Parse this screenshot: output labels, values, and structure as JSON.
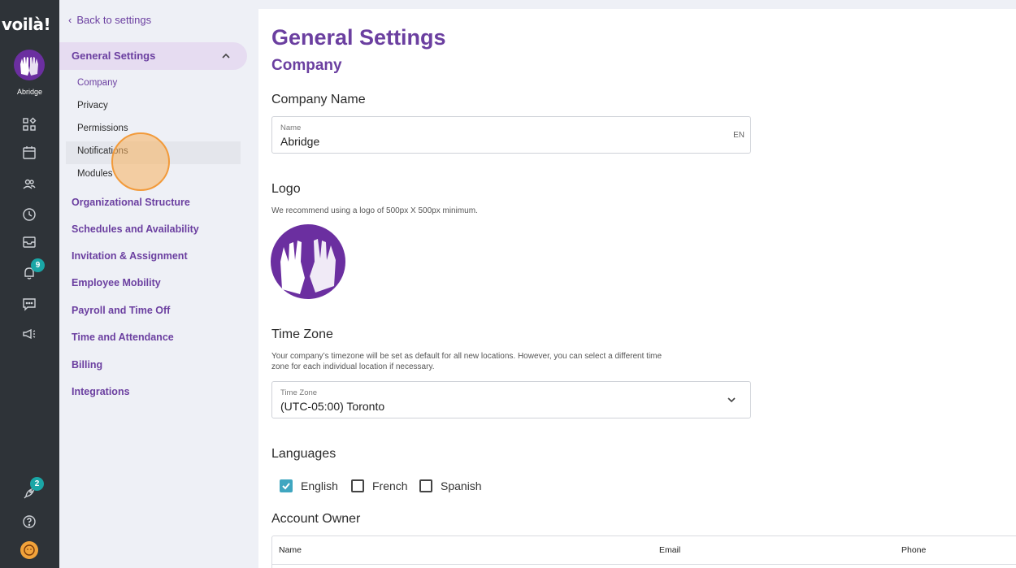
{
  "rail": {
    "brand": "voilà!",
    "org_name": "Abridge",
    "notifications_badge": "9",
    "launch_badge": "2",
    "icons": [
      "dashboard-icon",
      "calendar-icon",
      "people-icon",
      "clock-icon",
      "inbox-icon",
      "bell-icon",
      "chat-icon",
      "megaphone-icon",
      "rocket-icon",
      "help-icon",
      "user-avatar"
    ]
  },
  "sidebar": {
    "back_label": "Back to settings",
    "group_title": "General Settings",
    "sub_items": [
      "Company",
      "Privacy",
      "Permissions",
      "Notifications",
      "Modules"
    ],
    "active_sub": "Company",
    "nav_items": [
      "Organizational Structure",
      "Schedules and Availability",
      "Invitation & Assignment",
      "Employee Mobility",
      "Payroll and Time Off",
      "Time and Attendance",
      "Billing",
      "Integrations"
    ]
  },
  "main": {
    "title": "General Settings",
    "subtitle": "Company",
    "company_name": {
      "section": "Company Name",
      "label": "Name",
      "value": "Abridge",
      "lang": "EN"
    },
    "logo": {
      "section": "Logo",
      "helper": "We recommend using a logo of 500px X 500px minimum."
    },
    "timezone": {
      "section": "Time Zone",
      "helper_line1": "Your company’s timezone will be set as default for all new locations. However, you can select a different time",
      "helper_line2": "zone for each individual location if necessary.",
      "label": "Time Zone",
      "value": "(UTC-05:00) Toronto"
    },
    "languages": {
      "section": "Languages",
      "options": [
        {
          "label": "English",
          "checked": true
        },
        {
          "label": "French",
          "checked": false
        },
        {
          "label": "Spanish",
          "checked": false
        }
      ]
    },
    "account_owner": {
      "section": "Account Owner",
      "columns": [
        "Name",
        "Email",
        "Phone"
      ]
    }
  },
  "colors": {
    "accent": "#6b3fa0",
    "rail_bg": "#2e3338",
    "badge": "#1aa6a6",
    "checkbox": "#3fa6c0"
  }
}
